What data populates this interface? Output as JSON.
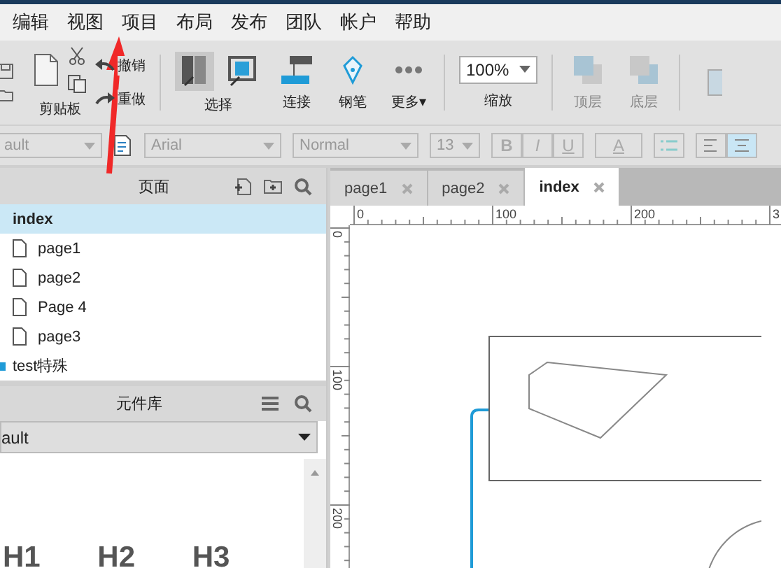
{
  "menu": [
    "编辑",
    "视图",
    "项目",
    "布局",
    "发布",
    "团队",
    "帐户",
    "帮助"
  ],
  "toolbar": {
    "clipboard": "剪贴板",
    "undo": "撤销",
    "redo": "重做",
    "select": "选择",
    "select_modes": [
      {
        "kind": "intersect",
        "selected": true
      },
      {
        "kind": "contain",
        "selected": false
      }
    ],
    "connect": "连接",
    "pen": "钢笔",
    "more": "更多▾",
    "zoom": {
      "value": "100%",
      "label": "缩放"
    },
    "front": "顶层",
    "back": "底层"
  },
  "format_bar": {
    "style": "ault",
    "font": "Arial",
    "weight": "Normal",
    "size": "13",
    "bold": "B",
    "italic": "I",
    "underline": "U",
    "text_color": "A",
    "align": [
      {
        "kind": "left",
        "selected": false
      },
      {
        "kind": "center",
        "selected": true
      }
    ]
  },
  "pages_panel": {
    "title": "页面",
    "pages": [
      {
        "label": "index",
        "kind": "page",
        "selected": true,
        "children": [
          {
            "label": "page1",
            "kind": "page",
            "selected": false
          },
          {
            "label": "page2",
            "kind": "page",
            "selected": false
          },
          {
            "label": "Page 4",
            "kind": "page",
            "selected": false
          },
          {
            "label": "page3",
            "kind": "page",
            "selected": false
          }
        ]
      },
      {
        "label": "test特殊",
        "kind": "folder",
        "selected": false
      }
    ]
  },
  "library_panel": {
    "title": "元件库",
    "library": "ault",
    "widgets": [
      "H1",
      "H2",
      "H3"
    ]
  },
  "tabs": [
    {
      "label": "page1",
      "selected": false
    },
    {
      "label": "page2",
      "selected": false
    },
    {
      "label": "index",
      "selected": true
    }
  ],
  "ruler": {
    "horizontal": [
      "0",
      "100",
      "200",
      "3"
    ],
    "vertical": [
      "0",
      "100",
      "200"
    ]
  }
}
